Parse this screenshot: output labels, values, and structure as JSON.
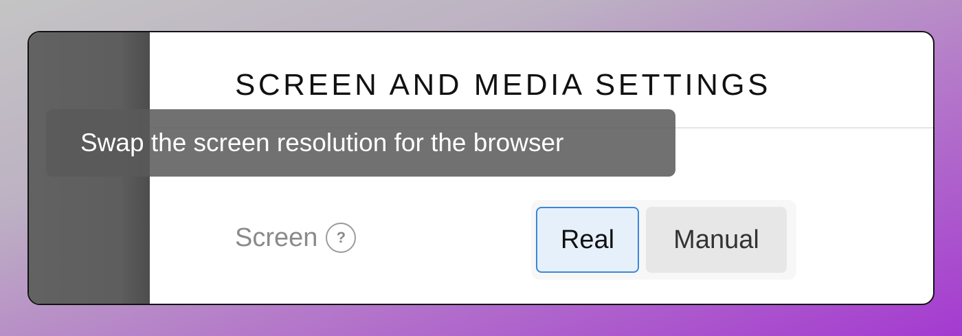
{
  "panel": {
    "title": "SCREEN AND MEDIA SETTINGS"
  },
  "tooltip": {
    "text": "Swap the screen resolution for the browser"
  },
  "screen_setting": {
    "label": "Screen",
    "help_icon_glyph": "?",
    "options": [
      {
        "label": "Real",
        "selected": true
      },
      {
        "label": "Manual",
        "selected": false
      }
    ]
  },
  "colors": {
    "selected_border": "#3a87d9",
    "selected_bg": "#e6f0fb",
    "sidebar": "#5e5e5e"
  }
}
